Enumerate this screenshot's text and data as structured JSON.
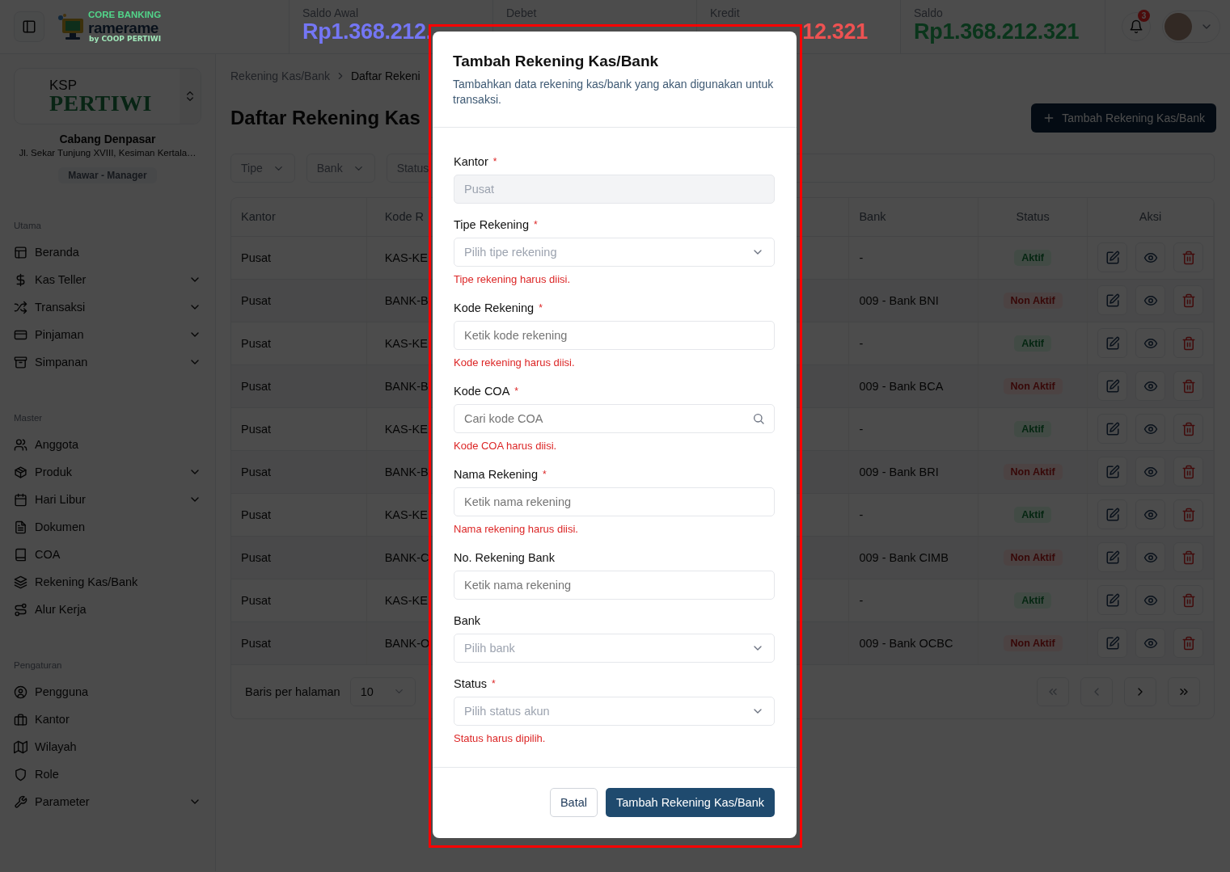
{
  "topbar": {
    "logo": {
      "line1": "CORE BANKING",
      "line2": "ramerame",
      "line3": "by COOP PERTIWI"
    },
    "stats": [
      {
        "label": "Saldo Awal",
        "value": "Rp1.368.212."
      },
      {
        "label": "Debet"
      },
      {
        "label": "Kredit",
        "value": "12.321"
      },
      {
        "label": "Saldo",
        "value": "Rp1.368.212.321"
      }
    ],
    "notification_count": "3"
  },
  "sidebar": {
    "org": {
      "logo_top": "KSP",
      "logo_main": "PERTIWI",
      "branch": "Cabang Denpasar",
      "address": "Jl. Sekar Tunjung XVIII, Kesiman Kertala…",
      "user": "Mawar - Manager"
    },
    "sections": [
      {
        "title": "Utama",
        "items": [
          {
            "label": "Beranda",
            "expandable": false
          },
          {
            "label": "Kas Teller",
            "expandable": true
          },
          {
            "label": "Transaksi",
            "expandable": true
          },
          {
            "label": "Pinjaman",
            "expandable": true
          },
          {
            "label": "Simpanan",
            "expandable": true
          }
        ]
      },
      {
        "title": "Master",
        "items": [
          {
            "label": "Anggota",
            "expandable": false
          },
          {
            "label": "Produk",
            "expandable": true
          },
          {
            "label": "Hari Libur",
            "expandable": true
          },
          {
            "label": "Dokumen",
            "expandable": false
          },
          {
            "label": "COA",
            "expandable": false
          },
          {
            "label": "Rekening Kas/Bank",
            "expandable": false
          },
          {
            "label": "Alur Kerja",
            "expandable": false
          }
        ]
      },
      {
        "title": "Pengaturan",
        "items": [
          {
            "label": "Pengguna",
            "expandable": false
          },
          {
            "label": "Kantor",
            "expandable": false
          },
          {
            "label": "Wilayah",
            "expandable": false
          },
          {
            "label": "Role",
            "expandable": false
          },
          {
            "label": "Parameter",
            "expandable": true
          }
        ]
      }
    ]
  },
  "content": {
    "breadcrumb": [
      "Rekening Kas/Bank",
      "Daftar Rekeni"
    ],
    "title": "Daftar Rekening Kas",
    "add_button": "Tambah Rekening Kas/Bank",
    "filters": [
      "Tipe",
      "Bank",
      "Status"
    ],
    "table": {
      "columns": [
        "Kantor",
        "Kode R",
        "Bank",
        "Status",
        "Aksi"
      ],
      "rows": [
        {
          "kantor": "Pusat",
          "code": "KAS-KE",
          "bank": "-",
          "status": "Aktif",
          "active": true
        },
        {
          "kantor": "Pusat",
          "code": "BANK-B",
          "bank": "009 - Bank BNI",
          "status": "Non Aktif",
          "active": false
        },
        {
          "kantor": "Pusat",
          "code": "KAS-KE",
          "bank": "-",
          "status": "Aktif",
          "active": true
        },
        {
          "kantor": "Pusat",
          "code": "BANK-B",
          "bank": "009 - Bank BCA",
          "status": "Non Aktif",
          "active": false
        },
        {
          "kantor": "Pusat",
          "code": "KAS-KE",
          "bank": "-",
          "status": "Aktif",
          "active": true
        },
        {
          "kantor": "Pusat",
          "code": "BANK-B",
          "bank": "009 - Bank BRI",
          "status": "Non Aktif",
          "active": false
        },
        {
          "kantor": "Pusat",
          "code": "KAS-KE",
          "bank": "-",
          "status": "Aktif",
          "active": true
        },
        {
          "kantor": "Pusat",
          "code": "BANK-C",
          "bank": "009 - Bank CIMB",
          "status": "Non Aktif",
          "active": false
        },
        {
          "kantor": "Pusat",
          "code": "KAS-KE",
          "bank": "-",
          "status": "Aktif",
          "active": true
        },
        {
          "kantor": "Pusat",
          "code": "BANK-O",
          "bank": "009 - Bank OCBC",
          "status": "Non Aktif",
          "active": false
        }
      ]
    },
    "rows_label": "Baris per halaman",
    "rows_value": "10"
  },
  "modal": {
    "title": "Tambah Rekening Kas/Bank",
    "description": "Tambahkan data rekening kas/bank yang akan digunakan untuk transaksi.",
    "fields": [
      {
        "kind": "input",
        "label": "Kantor",
        "required_mark": "*",
        "value": "Pusat",
        "disabled": true
      },
      {
        "kind": "select",
        "label": "Tipe Rekening",
        "required_mark": "*",
        "placeholder": "Pilih tipe rekening",
        "error": "Tipe rekening harus diisi.",
        "disabled": false
      },
      {
        "kind": "input",
        "label": "Kode Rekening",
        "required_mark": "*",
        "placeholder": "Ketik kode rekening",
        "error": "Kode rekening harus diisi.",
        "disabled": false
      },
      {
        "kind": "search",
        "label": "Kode COA",
        "required_mark": "*",
        "placeholder": "Cari kode COA",
        "error": "Kode COA harus diisi.",
        "disabled": false
      },
      {
        "kind": "input",
        "label": "Nama Rekening",
        "required_mark": "*",
        "placeholder": "Ketik nama rekening",
        "error": "Nama rekening harus diisi.",
        "disabled": false
      },
      {
        "kind": "input",
        "label": "No. Rekening Bank",
        "placeholder": "Ketik nama rekening",
        "disabled": false
      },
      {
        "kind": "select",
        "label": "Bank",
        "placeholder": "Pilih bank",
        "disabled": false
      },
      {
        "kind": "select",
        "label": "Status",
        "required_mark": "*",
        "placeholder": "Pilih status akun",
        "error": "Status harus dipilih.",
        "disabled": false
      }
    ],
    "cancel_button": "Batal",
    "submit_button": "Tambah Rekening Kas/Bank"
  }
}
